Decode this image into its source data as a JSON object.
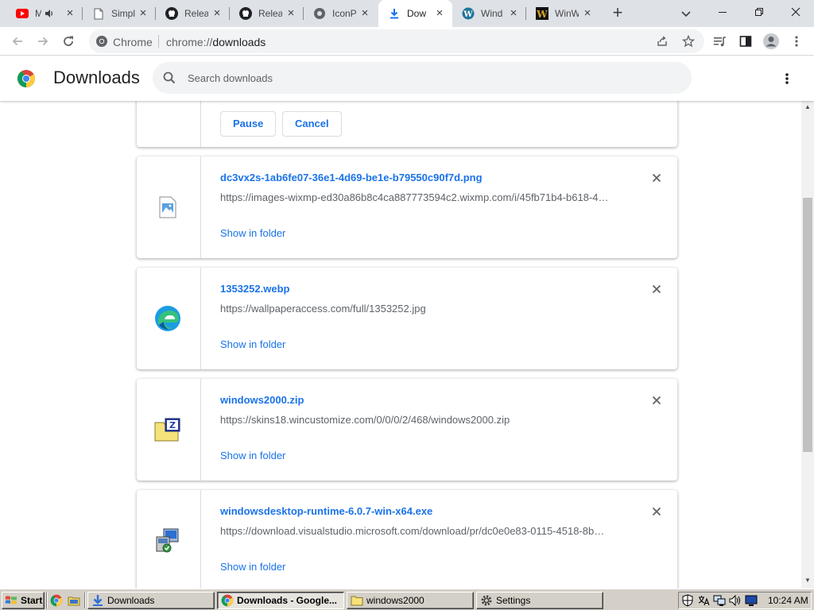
{
  "colors": {
    "accent": "#1a73e8",
    "tabstrip": "#dee1e6",
    "taskbar": "#d4d0c8"
  },
  "tabs": [
    {
      "title": "M",
      "icon": "youtube-icon",
      "muted_icon": "speaker-icon"
    },
    {
      "title": "Simpl",
      "icon": "page-icon"
    },
    {
      "title": "Relea",
      "icon": "github-icon"
    },
    {
      "title": "Relea",
      "icon": "github-icon"
    },
    {
      "title": "IconP",
      "icon": "globe-icon"
    },
    {
      "title": "Dow",
      "icon": "download-icon",
      "active": true
    },
    {
      "title": "Wind",
      "icon": "wordpress-icon"
    },
    {
      "title": "WinW",
      "icon": "winw-icon"
    }
  ],
  "toolbar": {
    "chip": "Chrome",
    "url_scheme": "chrome://",
    "url_host": "downloads"
  },
  "downloads_page": {
    "title": "Downloads",
    "search_placeholder": "Search downloads"
  },
  "partial_card": {
    "pause_label": "Pause",
    "cancel_label": "Cancel"
  },
  "items": [
    {
      "name": "dc3vx2s-1ab6fe07-36e1-4d69-be1e-b79550c90f7d.png",
      "url": "https://images-wixmp-ed30a86b8c4ca887773594c2.wixmp.com/i/45fb71b4-b618-4…",
      "show_label": "Show in folder",
      "icon": "image-file-icon"
    },
    {
      "name": "1353252.webp",
      "url": "https://wallpaperaccess.com/full/1353252.jpg",
      "show_label": "Show in folder",
      "icon": "edge-file-icon"
    },
    {
      "name": "windows2000.zip",
      "url": "https://skins18.wincustomize.com/0/0/0/2/468/windows2000.zip",
      "show_label": "Show in folder",
      "icon": "zip-folder-icon"
    },
    {
      "name": "windowsdesktop-runtime-6.0.7-win-x64.exe",
      "url": "https://download.visualstudio.microsoft.com/download/pr/dc0e0e83-0115-4518-8b…",
      "show_label": "Show in folder",
      "icon": "installer-icon"
    }
  ],
  "taskbar": {
    "start_label": "Start",
    "buttons": [
      {
        "label": "Downloads",
        "icon": "download-folder-icon"
      },
      {
        "label": "Downloads - Google...",
        "icon": "chrome-icon",
        "active": true
      },
      {
        "label": "windows2000",
        "icon": "folder-icon"
      },
      {
        "label": "Settings",
        "icon": "settings-gear-icon"
      }
    ],
    "clock": "10:24 AM"
  }
}
